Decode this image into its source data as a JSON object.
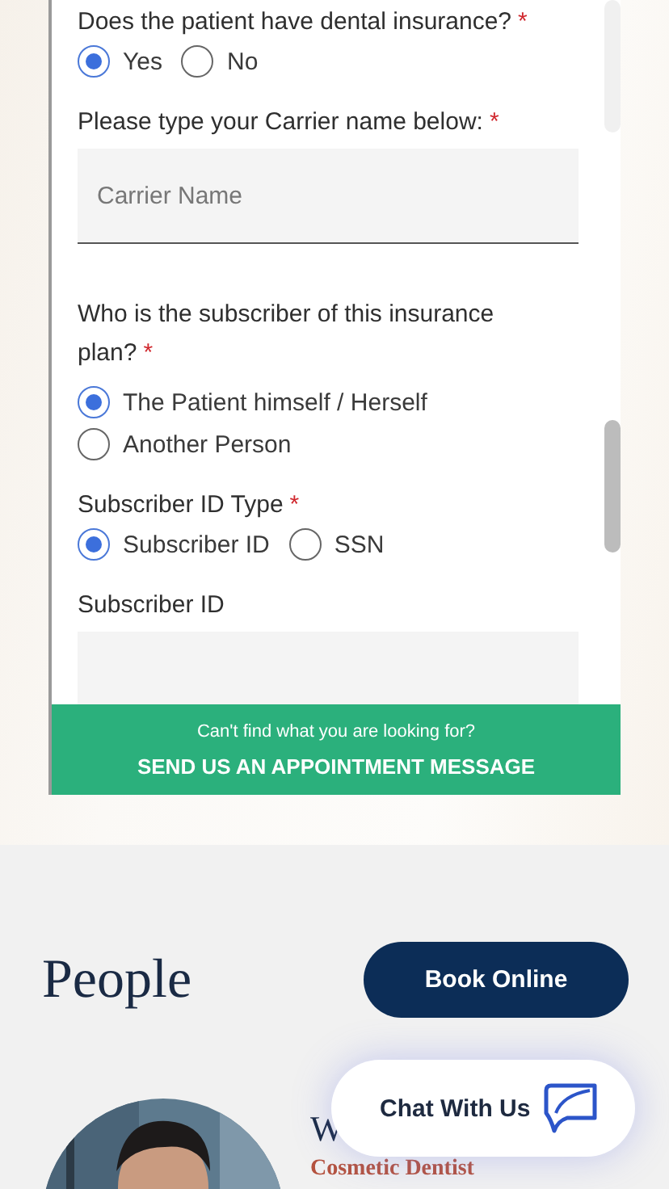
{
  "form": {
    "questions": [
      {
        "kind": "radio_row",
        "label": "Does the patient have dental insurance?",
        "mark": "*",
        "options": [
          {
            "label": "Yes",
            "selected": true
          },
          {
            "label": "No",
            "selected": false
          }
        ]
      },
      {
        "kind": "text",
        "label": "Please type your Carrier name below:",
        "mark": "*",
        "placeholder": "Carrier Name"
      },
      {
        "kind": "radio_list",
        "label": "Who is the subscriber of this insurance plan?",
        "mark": "*",
        "options": [
          {
            "label": "The Patient himself / Herself",
            "selected": true
          },
          {
            "label": "Another Person",
            "selected": false
          }
        ]
      },
      {
        "kind": "radio_row",
        "label": "Subscriber ID Type",
        "mark": "*",
        "options": [
          {
            "label": "Subscriber ID",
            "selected": true
          },
          {
            "label": "SSN",
            "selected": false
          }
        ]
      },
      {
        "kind": "text",
        "label": "Subscriber ID"
      }
    ]
  },
  "banner": {
    "hint": "Can't find what you are looking for?",
    "action": "SEND US AN APPOINTMENT MESSAGE"
  },
  "people": {
    "title": "People",
    "book_button": "Book Online",
    "person": {
      "name": "W",
      "role": "Cosmetic Dentist"
    }
  },
  "chat": {
    "label": "Chat With Us"
  }
}
